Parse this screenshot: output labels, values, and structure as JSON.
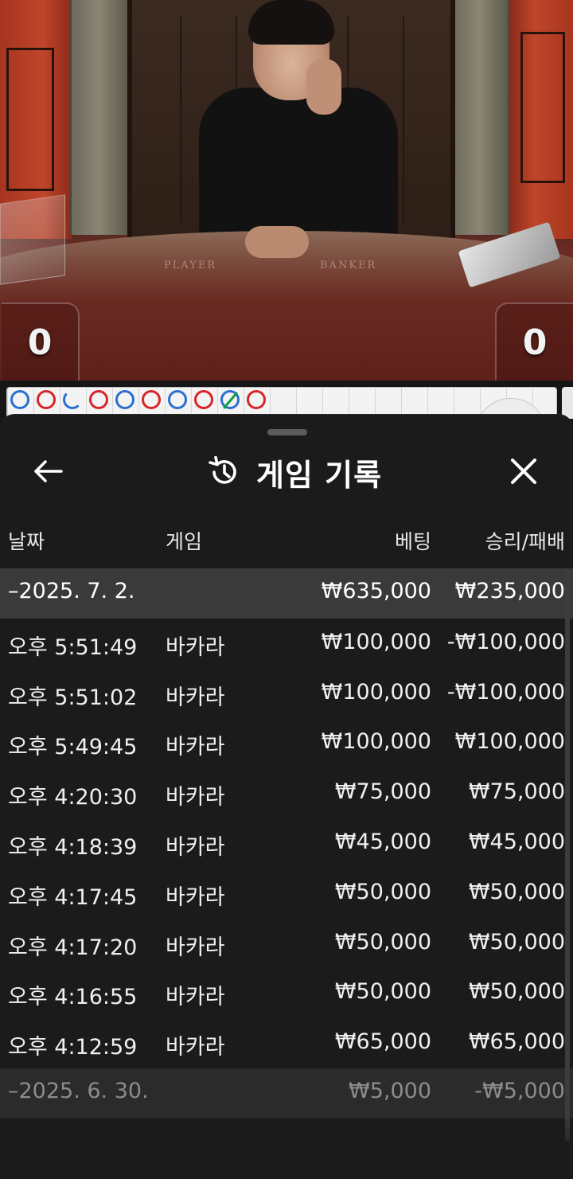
{
  "live_view": {
    "player_label": "PLAYER",
    "banker_label": "BANKER",
    "player_score": "0",
    "banker_score": "0"
  },
  "road": {
    "beads": [
      "P",
      "B",
      "P",
      "B",
      "P",
      "B",
      "P",
      "B",
      "P",
      "B"
    ]
  },
  "sheet": {
    "title": "게임 기록",
    "icons": {
      "back": "arrow-left-icon",
      "history": "history-icon",
      "close": "close-icon"
    }
  },
  "table": {
    "columns": {
      "date": "날짜",
      "game": "게임",
      "bet": "베팅",
      "win_loss": "승리/패배"
    },
    "groups": [
      {
        "date": "–2025. 7. 2.",
        "bet": "₩635,000",
        "win_loss": "₩235,000",
        "rows": [
          {
            "time": "오후 5:51:49",
            "game": "바카라",
            "bet": "₩100,000",
            "win_loss": "-₩100,000"
          },
          {
            "time": "오후 5:51:02",
            "game": "바카라",
            "bet": "₩100,000",
            "win_loss": "-₩100,000"
          },
          {
            "time": "오후 5:49:45",
            "game": "바카라",
            "bet": "₩100,000",
            "win_loss": "₩100,000"
          },
          {
            "time": "오후 4:20:30",
            "game": "바카라",
            "bet": "₩75,000",
            "win_loss": "₩75,000"
          },
          {
            "time": "오후 4:18:39",
            "game": "바카라",
            "bet": "₩45,000",
            "win_loss": "₩45,000"
          },
          {
            "time": "오후 4:17:45",
            "game": "바카라",
            "bet": "₩50,000",
            "win_loss": "₩50,000"
          },
          {
            "time": "오후 4:17:20",
            "game": "바카라",
            "bet": "₩50,000",
            "win_loss": "₩50,000"
          },
          {
            "time": "오후 4:16:55",
            "game": "바카라",
            "bet": "₩50,000",
            "win_loss": "₩50,000"
          },
          {
            "time": "오후 4:12:59",
            "game": "바카라",
            "bet": "₩65,000",
            "win_loss": "₩65,000"
          }
        ]
      },
      {
        "date": "–2025. 6. 30.",
        "bet": "₩5,000",
        "win_loss": "-₩5,000",
        "rows": []
      }
    ]
  },
  "colors": {
    "banker_red": "#d7262b",
    "player_blue": "#2a6fd1",
    "tie_green": "#0f9d3a",
    "sheet_bg": "#1b1b1b",
    "group_row_bg": "#3a3a3a"
  }
}
